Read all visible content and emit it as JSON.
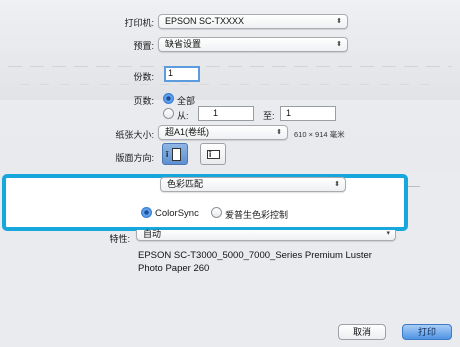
{
  "printer": {
    "label": "打印机:",
    "value": "EPSON SC-TXXXX"
  },
  "preset": {
    "label": "预置:",
    "value": "缺省设置"
  },
  "copies": {
    "label": "份数:",
    "value": "1"
  },
  "pages": {
    "label": "页数:",
    "all_label": "全部",
    "from_label": "从:",
    "from_value": "1",
    "to_label": "至:",
    "to_value": "1"
  },
  "paper_size": {
    "label": "纸张大小:",
    "value": "超A1(卷纸)",
    "dimensions": "610 × 914 毫米"
  },
  "orientation": {
    "label": "版面方向:"
  },
  "panel_menu": {
    "value": "色彩匹配"
  },
  "color_matching": {
    "option_colorsync": "ColorSync",
    "option_epson": "爱普生色彩控制"
  },
  "profile": {
    "label": "特性:",
    "value": "自动",
    "description_line1": "EPSON SC-T3000_5000_7000_Series Premium Luster",
    "description_line2": "Photo Paper 260"
  },
  "buttons": {
    "cancel": "取消",
    "print": "打印"
  },
  "colors": {
    "highlight": "#17a7dd",
    "focus": "#5b9bde",
    "default_button": "#4f94e4"
  }
}
